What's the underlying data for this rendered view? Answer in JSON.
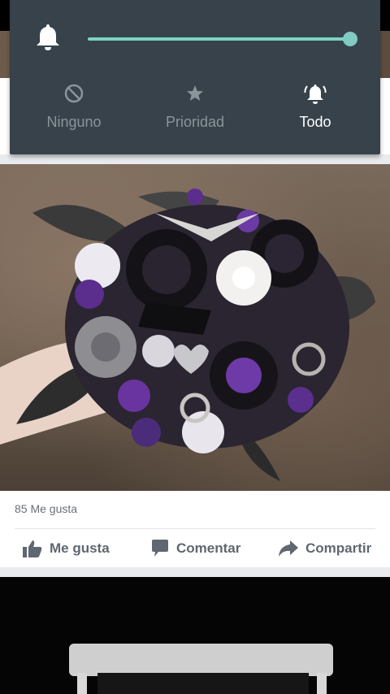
{
  "notification_panel": {
    "volume_level": 1.0,
    "modes": [
      {
        "label": "Ninguno",
        "icon": "block-icon"
      },
      {
        "label": "Prioridad",
        "icon": "star-icon"
      },
      {
        "label": "Todo",
        "icon": "ringing-bell-icon"
      }
    ],
    "selected_mode": "Todo"
  },
  "post": {
    "likes_text": "85 Me gusta",
    "actions": {
      "like": "Me gusta",
      "comment": "Comentar",
      "share": "Compartir"
    }
  },
  "colors": {
    "panel_bg": "#37424a",
    "slider_accent": "#80cbc4",
    "action_text": "#5f6770"
  }
}
